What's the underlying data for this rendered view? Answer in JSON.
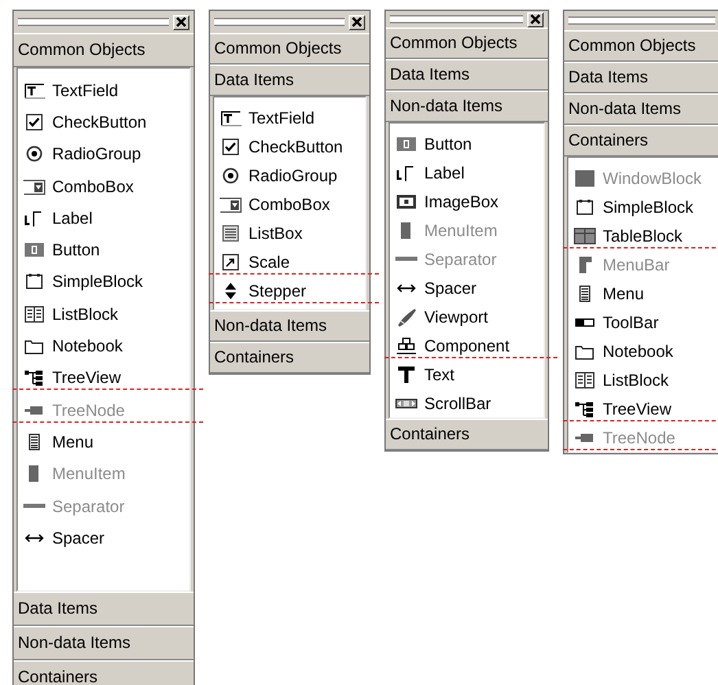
{
  "panels": [
    {
      "sections": [
        {
          "title": "Common Objects",
          "items": [
            {
              "label": "TextField",
              "kind": "textfield",
              "disabled": false,
              "marked": false
            },
            {
              "label": "CheckButton",
              "kind": "checkbutton",
              "disabled": false,
              "marked": false
            },
            {
              "label": "RadioGroup",
              "kind": "radiogroup",
              "disabled": false,
              "marked": false
            },
            {
              "label": "ComboBox",
              "kind": "combobox",
              "disabled": false,
              "marked": false
            },
            {
              "label": "Label",
              "kind": "label",
              "disabled": false,
              "marked": false
            },
            {
              "label": "Button",
              "kind": "button",
              "disabled": false,
              "marked": false
            },
            {
              "label": "SimpleBlock",
              "kind": "simpleblock",
              "disabled": false,
              "marked": false
            },
            {
              "label": "ListBlock",
              "kind": "listblock",
              "disabled": false,
              "marked": false
            },
            {
              "label": "Notebook",
              "kind": "notebook",
              "disabled": false,
              "marked": false
            },
            {
              "label": "TreeView",
              "kind": "treeview",
              "disabled": false,
              "marked": true
            },
            {
              "label": "TreeNode",
              "kind": "treenode",
              "disabled": true,
              "marked": true
            },
            {
              "label": "Menu",
              "kind": "menu",
              "disabled": false,
              "marked": false
            },
            {
              "label": "MenuItem",
              "kind": "menuitem",
              "disabled": true,
              "marked": false
            },
            {
              "label": "Separator",
              "kind": "separator",
              "disabled": true,
              "marked": false
            },
            {
              "label": "Spacer",
              "kind": "spacer",
              "disabled": false,
              "marked": false
            }
          ]
        },
        {
          "title": "Data Items"
        },
        {
          "title": "Non-data Items"
        },
        {
          "title": "Containers"
        }
      ]
    },
    {
      "sections": [
        {
          "title": "Common Objects"
        },
        {
          "title": "Data Items",
          "items": [
            {
              "label": "TextField",
              "kind": "textfield",
              "disabled": false,
              "marked": false
            },
            {
              "label": "CheckButton",
              "kind": "checkbutton",
              "disabled": false,
              "marked": false
            },
            {
              "label": "RadioGroup",
              "kind": "radiogroup",
              "disabled": false,
              "marked": false
            },
            {
              "label": "ComboBox",
              "kind": "combobox",
              "disabled": false,
              "marked": false
            },
            {
              "label": "ListBox",
              "kind": "listbox",
              "disabled": false,
              "marked": false
            },
            {
              "label": "Scale",
              "kind": "scale",
              "disabled": false,
              "marked": true
            },
            {
              "label": "Stepper",
              "kind": "stepper",
              "disabled": false,
              "marked": true
            }
          ]
        },
        {
          "title": "Non-data Items"
        },
        {
          "title": "Containers"
        }
      ]
    },
    {
      "sections": [
        {
          "title": "Common Objects"
        },
        {
          "title": "Data Items"
        },
        {
          "title": "Non-data Items",
          "items": [
            {
              "label": "Button",
              "kind": "button",
              "disabled": false,
              "marked": false
            },
            {
              "label": "Label",
              "kind": "label",
              "disabled": false,
              "marked": false
            },
            {
              "label": "ImageBox",
              "kind": "imagebox",
              "disabled": false,
              "marked": false
            },
            {
              "label": "MenuItem",
              "kind": "menuitem",
              "disabled": true,
              "marked": false
            },
            {
              "label": "Separator",
              "kind": "separator",
              "disabled": true,
              "marked": false
            },
            {
              "label": "Spacer",
              "kind": "spacer",
              "disabled": false,
              "marked": false
            },
            {
              "label": "Viewport",
              "kind": "viewport",
              "disabled": false,
              "marked": false
            },
            {
              "label": "Component",
              "kind": "component",
              "disabled": false,
              "marked": true
            },
            {
              "label": "Text",
              "kind": "text",
              "disabled": false,
              "marked": false
            },
            {
              "label": "ScrollBar",
              "kind": "scrollbar",
              "disabled": false,
              "marked": false
            }
          ]
        },
        {
          "title": "Containers"
        }
      ]
    },
    {
      "sections": [
        {
          "title": "Common Objects"
        },
        {
          "title": "Data Items"
        },
        {
          "title": "Non-data Items"
        },
        {
          "title": "Containers",
          "items": [
            {
              "label": "WindowBlock",
              "kind": "windowblock",
              "disabled": true,
              "marked": false
            },
            {
              "label": "SimpleBlock",
              "kind": "simpleblock",
              "disabled": false,
              "marked": false
            },
            {
              "label": "TableBlock",
              "kind": "tableblock",
              "disabled": false,
              "marked": true
            },
            {
              "label": "MenuBar",
              "kind": "menubar",
              "disabled": true,
              "marked": false
            },
            {
              "label": "Menu",
              "kind": "menu",
              "disabled": false,
              "marked": false
            },
            {
              "label": "ToolBar",
              "kind": "toolbar",
              "disabled": false,
              "marked": false
            },
            {
              "label": "Notebook",
              "kind": "notebook",
              "disabled": false,
              "marked": false
            },
            {
              "label": "ListBlock",
              "kind": "listblock",
              "disabled": false,
              "marked": false
            },
            {
              "label": "TreeView",
              "kind": "treeview",
              "disabled": false,
              "marked": true
            },
            {
              "label": "TreeNode",
              "kind": "treenode",
              "disabled": true,
              "marked": true
            }
          ]
        }
      ]
    }
  ]
}
